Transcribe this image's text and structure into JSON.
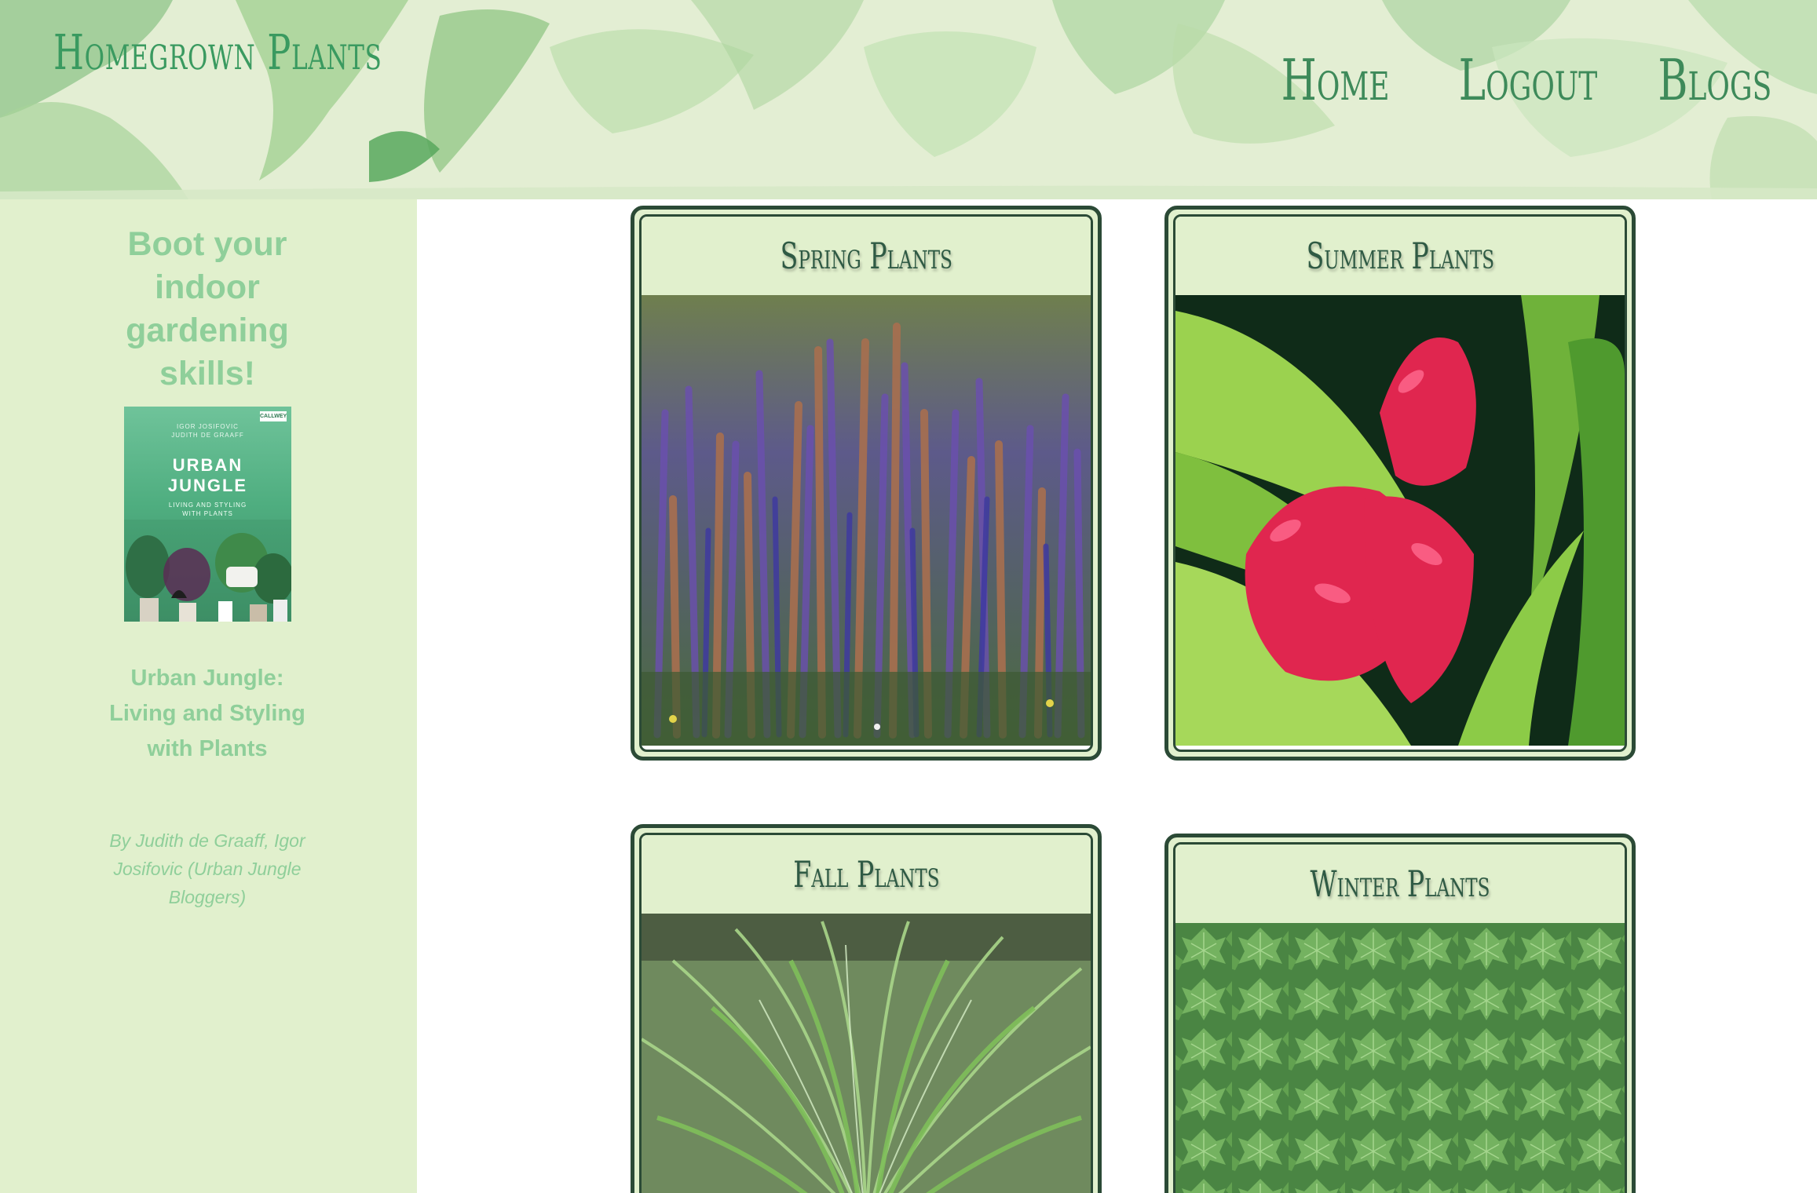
{
  "header": {
    "site_title": "Homegrown Plants",
    "nav": [
      {
        "label": "Home"
      },
      {
        "label": "Logout"
      },
      {
        "label": "Blogs"
      }
    ]
  },
  "sidebar": {
    "heading": "Boot your indoor gardening skills!",
    "book": {
      "cover_authors_line1": "IGOR JOSIFOVIC",
      "cover_authors_line2": "JUDITH DE GRAAFF",
      "cover_publisher": "CALLWEY",
      "cover_title_line1": "URBAN",
      "cover_title_line2": "JUNGLE",
      "cover_subtitle_line1": "LIVING AND STYLING",
      "cover_subtitle_line2": "WITH PLANTS",
      "title": "Urban Jungle: Living and Styling with Plants",
      "byline": "By Judith de Graaff, Igor Josifovic (Urban Jungle Bloggers)"
    }
  },
  "cards": [
    {
      "title": "Spring Plants",
      "image": "lavender-salvia-photo"
    },
    {
      "title": "Summer Plants",
      "image": "red-ginger-flower-photo"
    },
    {
      "title": "Fall Plants",
      "image": "ornamental-grass-photo"
    },
    {
      "title": "Winter Plants",
      "image": "ivy-leaves-photo"
    }
  ],
  "colors": {
    "accent_green": "#3a9a60",
    "sidebar_bg": "#e1f0cd",
    "sidebar_text": "#8fcf9a",
    "card_border": "#2b4a36"
  }
}
